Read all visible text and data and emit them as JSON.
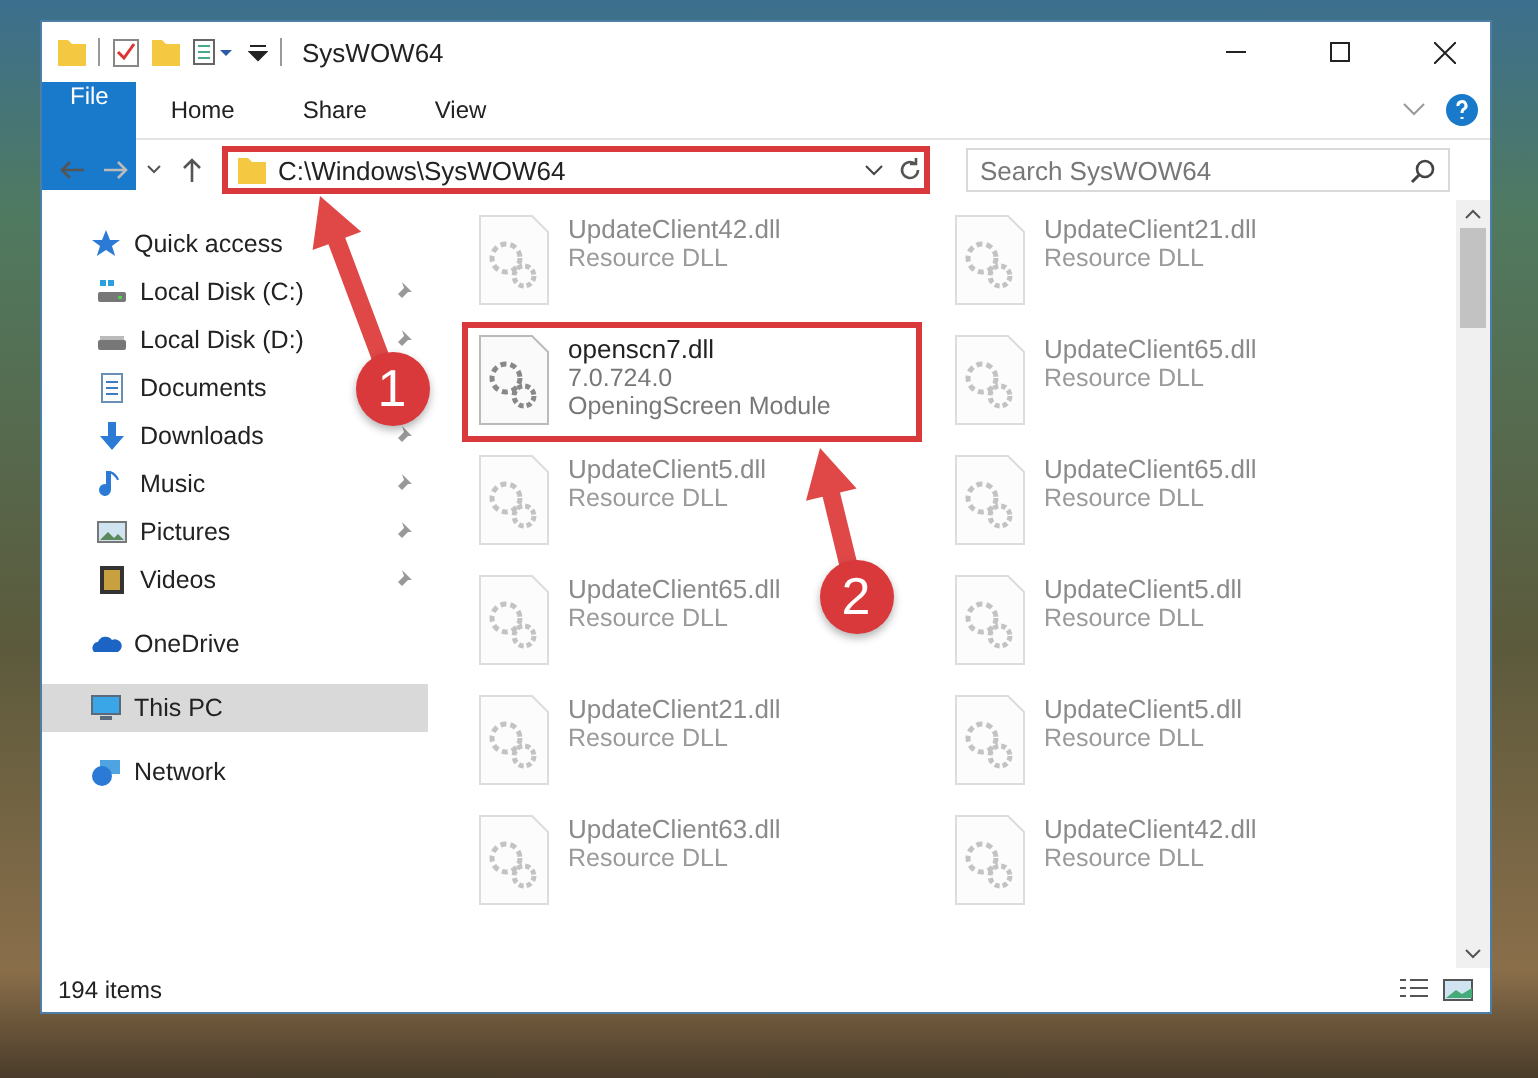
{
  "window": {
    "title": "SysWOW64"
  },
  "ribbon_tabs": [
    {
      "label": "File",
      "kind": "file",
      "selected": false
    },
    {
      "label": "Home",
      "kind": "tab",
      "selected": false
    },
    {
      "label": "Share",
      "kind": "tab",
      "selected": false
    },
    {
      "label": "View",
      "kind": "tab",
      "selected": false
    }
  ],
  "address_bar": {
    "value": "C:\\Windows\\SysWOW64",
    "annotated": true
  },
  "search": {
    "placeholder": "Search SysWOW64"
  },
  "sidebar": {
    "items": [
      {
        "label": "Quick access",
        "kind": "star",
        "selected": false,
        "children": [
          {
            "label": "Local Disk (C:)",
            "kind": "drive-windows",
            "pinned": true,
            "selected": false
          },
          {
            "label": "Local Disk (D:)",
            "kind": "drive",
            "pinned": true,
            "selected": false
          },
          {
            "label": "Documents",
            "kind": "documents",
            "selected": false
          },
          {
            "label": "Downloads",
            "kind": "downloads",
            "pinned": true,
            "selected": false
          },
          {
            "label": "Music",
            "kind": "music",
            "pinned": true,
            "selected": false
          },
          {
            "label": "Pictures",
            "kind": "pictures",
            "pinned": true,
            "selected": false
          },
          {
            "label": "Videos",
            "kind": "videos",
            "pinned": true,
            "selected": false
          }
        ]
      },
      {
        "label": "OneDrive",
        "kind": "cloud",
        "selected": false
      },
      {
        "label": "This PC",
        "kind": "pc",
        "selected": true
      },
      {
        "label": "Network",
        "kind": "network",
        "selected": false
      }
    ]
  },
  "files": [
    {
      "name": "UpdateClient42.dll",
      "details": [
        "Resource DLL"
      ],
      "dimmed": true,
      "annotated": false
    },
    {
      "name": "UpdateClient21.dll",
      "details": [
        "Resource DLL"
      ],
      "dimmed": true,
      "annotated": false
    },
    {
      "name": "openscn7.dll",
      "details": [
        "7.0.724.0",
        "OpeningScreen Module"
      ],
      "dimmed": false,
      "annotated": true
    },
    {
      "name": "UpdateClient65.dll",
      "details": [
        "Resource DLL"
      ],
      "dimmed": true,
      "annotated": false
    },
    {
      "name": "UpdateClient5.dll",
      "details": [
        "Resource DLL"
      ],
      "dimmed": true,
      "annotated": false
    },
    {
      "name": "UpdateClient65.dll",
      "details": [
        "Resource DLL"
      ],
      "dimmed": true,
      "annotated": false
    },
    {
      "name": "UpdateClient65.dll",
      "details": [
        "Resource DLL"
      ],
      "dimmed": true,
      "annotated": false
    },
    {
      "name": "UpdateClient5.dll",
      "details": [
        "Resource DLL"
      ],
      "dimmed": true,
      "annotated": false
    },
    {
      "name": "UpdateClient21.dll",
      "details": [
        "Resource DLL"
      ],
      "dimmed": true,
      "annotated": false
    },
    {
      "name": "UpdateClient5.dll",
      "details": [
        "Resource DLL"
      ],
      "dimmed": true,
      "annotated": false
    },
    {
      "name": "UpdateClient63.dll",
      "details": [
        "Resource DLL"
      ],
      "dimmed": true,
      "annotated": false
    },
    {
      "name": "UpdateClient42.dll",
      "details": [
        "Resource DLL"
      ],
      "dimmed": true,
      "annotated": false
    }
  ],
  "status_bar": {
    "count": "194 items"
  },
  "callouts": [
    {
      "number": "1"
    },
    {
      "number": "2"
    }
  ]
}
